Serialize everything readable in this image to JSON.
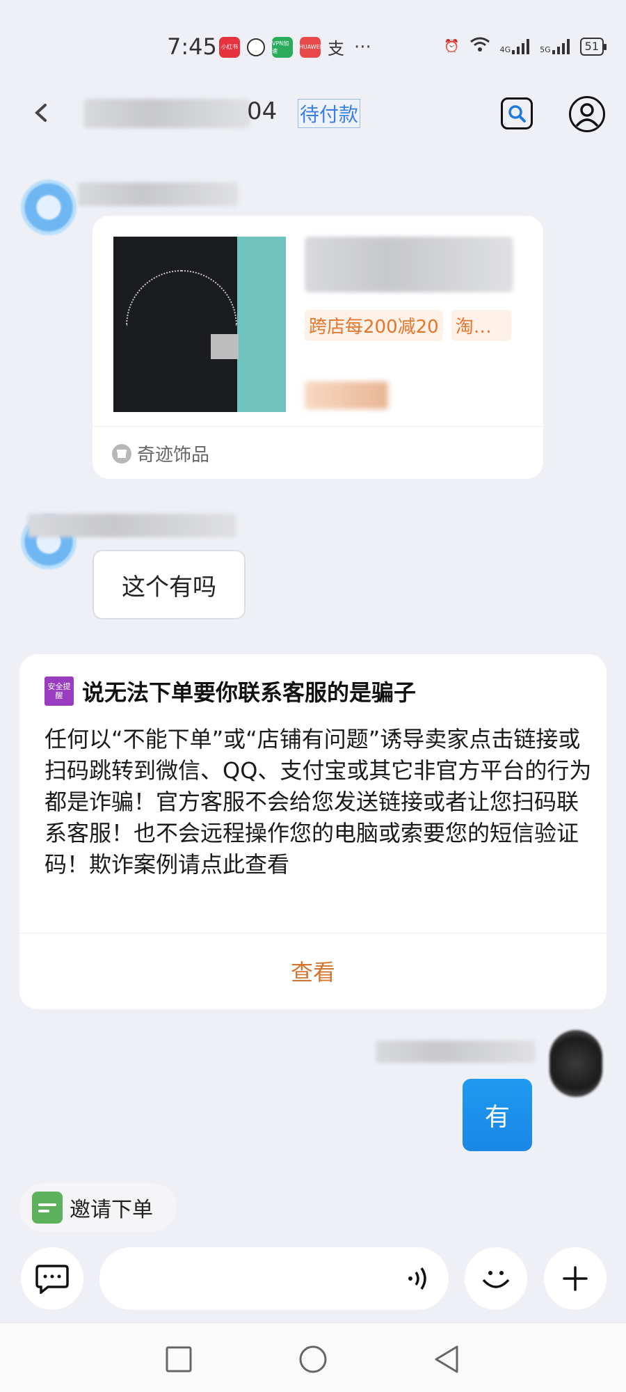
{
  "status_bar": {
    "time": "7:45",
    "more": "···",
    "battery": "51",
    "net1": "4G",
    "net2": "5G",
    "app_icons": [
      "小红书",
      "VPN加速",
      "HUAWEI"
    ]
  },
  "header": {
    "title_suffix": "04",
    "order_status": "待付款"
  },
  "product_card": {
    "tags": [
      "跨店每200减20",
      "淘…"
    ],
    "shop_name": "奇迹饰品"
  },
  "messages": {
    "buyer_question": "这个有吗",
    "seller_reply": "有"
  },
  "warning_card": {
    "badge": "安全提醒",
    "title": "说无法下单要你联系客服的是骗子",
    "body": "任何以“不能下单”或“店铺有问题”诱导卖家点击链接或扫码跳转到微信、QQ、支付宝或其它非官方平台的行为都是诈骗！官方客服不会给您发送链接或者让您扫码联系客服！也不会远程操作您的电脑或索要您的短信验证码！欺诈案例请点此查看",
    "action": "查看"
  },
  "invite_chip": {
    "label": "邀请下单"
  },
  "input_bar": {
    "placeholder": ""
  },
  "colors": {
    "accent_blue": "#1f9bf0",
    "tag_orange": "#e8752c",
    "warning_purple": "#9a3cbf",
    "invite_green": "#5cb15a",
    "background": "#eef0f6"
  },
  "icons": [
    "back-arrow-icon",
    "search-icon",
    "profile-icon",
    "shop-icon",
    "shield-icon",
    "chat-bubble-icon",
    "voice-icon",
    "emoji-icon",
    "plus-icon",
    "square-icon",
    "circle-icon",
    "triangle-back-icon"
  ]
}
